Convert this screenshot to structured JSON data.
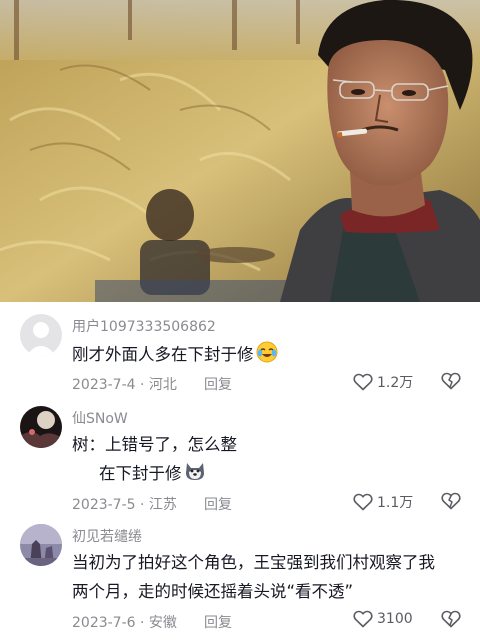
{
  "comments": [
    {
      "username": "用户1097333506862",
      "lines": [
        "刚才外面人多在下封于修"
      ],
      "emoji": "crying-laugh-emoji",
      "date_location": "2023-7-4 · 河北",
      "reply_label": "回复",
      "likes": "1.2万"
    },
    {
      "username": "仙SNoW",
      "lines": [
        "树：上错号了，怎么整",
        "在下封于修"
      ],
      "emoji": "husky-emoji",
      "date_location": "2023-7-5 · 江苏",
      "reply_label": "回复",
      "likes": "1.1万"
    },
    {
      "username": "初见若缱绻",
      "lines": [
        "当初为了拍好这个角色，王宝强到我们村观察了我",
        "两个月，走的时候还摇着头说“看不透”"
      ],
      "date_location": "2023-7-6 · 安徽",
      "reply_label": "回复",
      "likes": "3100"
    }
  ],
  "icons": {
    "like": "heart-outline-icon",
    "dislike": "broken-heart-icon"
  },
  "colors": {
    "text_primary": "#161823",
    "text_secondary": "#8a8b91"
  }
}
